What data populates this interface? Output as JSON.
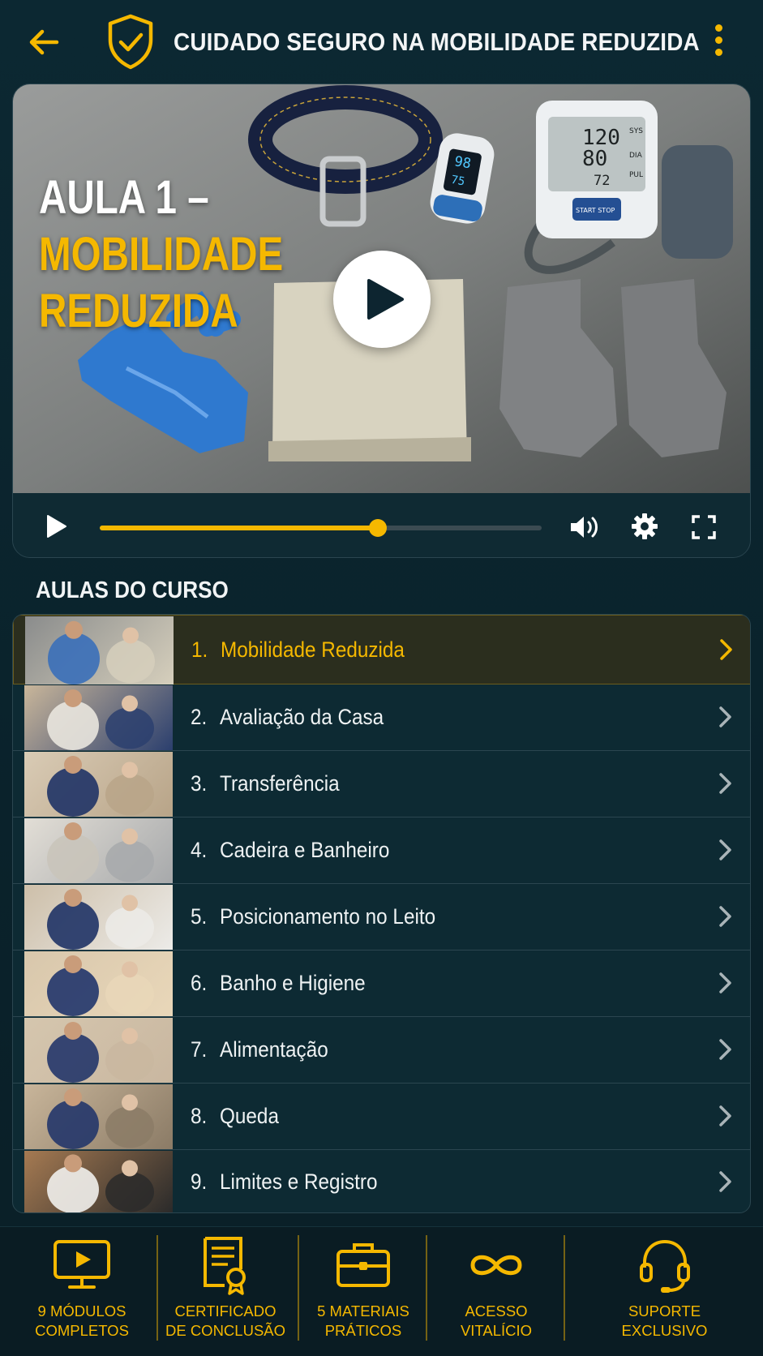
{
  "header": {
    "title": "CUIDADO SEGURO NA MOBILIDADE REDUZIDA",
    "accent_color": "#f5b800"
  },
  "video": {
    "title_line1": "AULA 1 –",
    "title_line2": "MOBILIDADE",
    "title_line3": "REDUZIDA",
    "monitor_readout": [
      "120",
      "80",
      "72"
    ],
    "monitor_labels": [
      "SYS",
      "DIA",
      "PUL"
    ],
    "monitor_button": "START STOP",
    "oximeter_readout": [
      "98",
      "75"
    ],
    "progress": 0.63
  },
  "lessons_section": {
    "title": "AULAS DO CURSO",
    "items": [
      {
        "number": "1.",
        "label": "Mobilidade Reduzida",
        "active": true
      },
      {
        "number": "2.",
        "label": "Avaliação da Casa",
        "active": false
      },
      {
        "number": "3.",
        "label": "Transferência",
        "active": false
      },
      {
        "number": "4.",
        "label": "Cadeira e Banheiro",
        "active": false
      },
      {
        "number": "5.",
        "label": "Posicionamento no Leito",
        "active": false
      },
      {
        "number": "6.",
        "label": "Banho e Higiene",
        "active": false
      },
      {
        "number": "7.",
        "label": "Alimentação",
        "active": false
      },
      {
        "number": "8.",
        "label": "Queda",
        "active": false
      },
      {
        "number": "9.",
        "label": "Limites e Registro",
        "active": false
      }
    ]
  },
  "features": [
    {
      "icon": "monitor-play-icon",
      "label": "9 MÓDULOS\nCOMPLETOS"
    },
    {
      "icon": "certificate-icon",
      "label": "CERTIFICADO\nDE CONCLUSÃO"
    },
    {
      "icon": "briefcase-icon",
      "label": "5 MATERIAIS\nPRÁTICOS"
    },
    {
      "icon": "infinity-icon",
      "label": "ACESSO\nVITALÍCIO"
    },
    {
      "icon": "headset-icon",
      "label": "SUPORTE\nEXCLUSIVO"
    }
  ]
}
